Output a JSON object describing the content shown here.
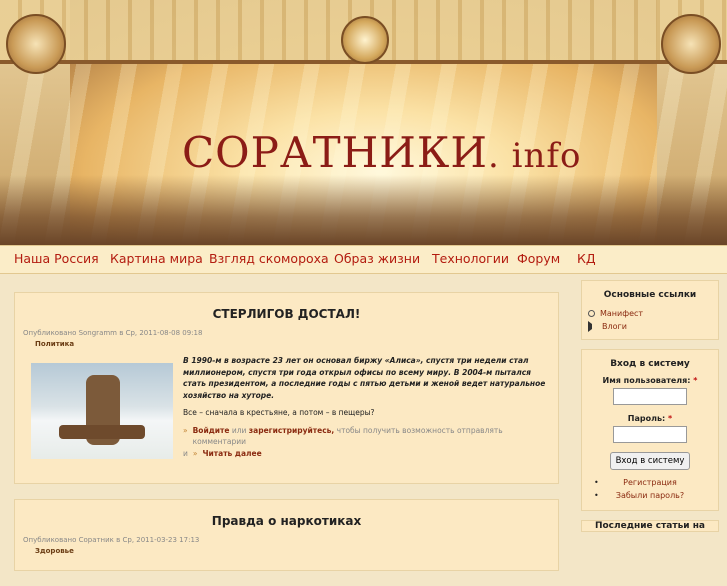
{
  "site": {
    "title_main": "СОРАТНИКИ",
    "title_domain": ". info"
  },
  "nav": [
    "Наша Россия",
    "Картина мира",
    "Взгляд скомороха",
    "Образ жизни",
    "Технологии",
    "Форум",
    "КД"
  ],
  "posts": [
    {
      "title": "СТЕРЛИГОВ ДОСТАЛ!",
      "meta": "Опубликовано Songramm в Ср, 2011-08-08 09:18",
      "tag": "Политика",
      "lead": "В 1990-м в возрасте 23 лет он основал биржу «Алиса», спустя три недели стал миллионером, спустя три года открыл офисы по всему миру. В 2004-м пытался стать президентом, а последние годы с пятью детьми и женой ведет натуральное хозяйство на хуторе.",
      "text": "Все – сначала в крестьяне, а потом – в пещеры?",
      "login_link": "Войдите",
      "or": "или",
      "register_link": "зарегистрируйтесь,",
      "login_suffix": "чтобы получить возможность отправлять комментарии",
      "and": "и",
      "read_more": "Читать далее"
    },
    {
      "title": "Правда о наркотиках",
      "meta": "Опубликовано Соратник в Ср, 2011-03-23 17:13",
      "tag": "Здоровье"
    }
  ],
  "sidebar": {
    "links_title": "Основные ссылки",
    "links": [
      "Манифест",
      "Влоги"
    ],
    "login_title": "Вход в систему",
    "username_label": "Имя пользователя:",
    "password_label": "Пароль:",
    "required": "*",
    "login_button": "Вход в систему",
    "register": "Регистрация",
    "forgot": "Забыли пароль?",
    "bullet": "•",
    "recent_title": "Последние статьи на"
  }
}
